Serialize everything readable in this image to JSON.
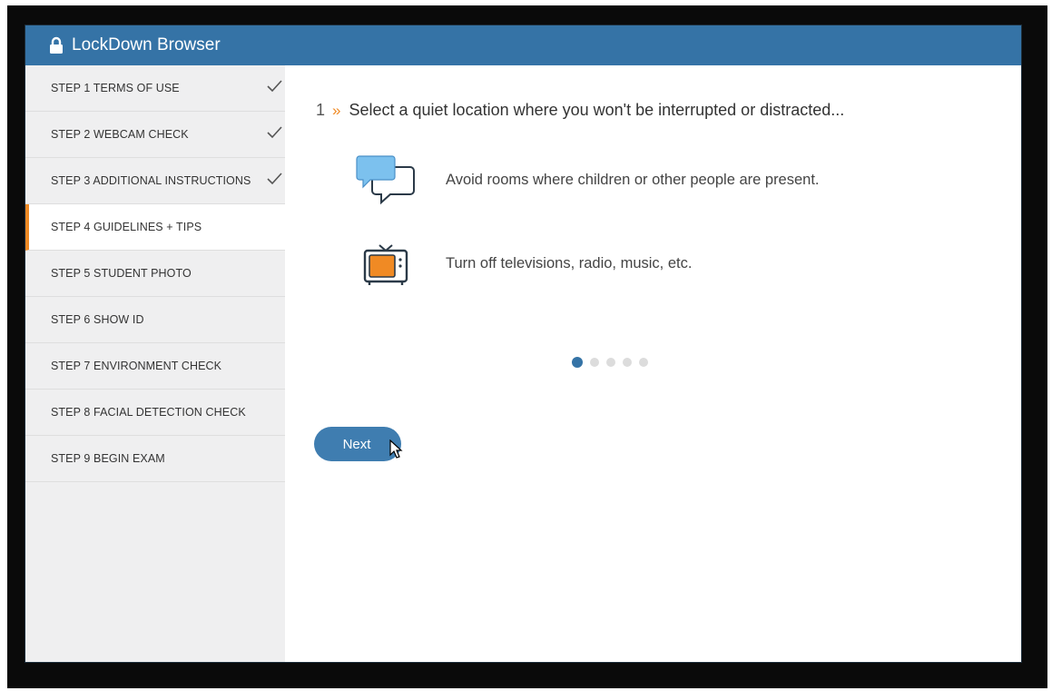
{
  "window": {
    "title": "LockDown Browser"
  },
  "sidebar": {
    "steps": [
      {
        "label": "STEP 1 TERMS OF USE",
        "completed": true
      },
      {
        "label": "STEP 2 WEBCAM CHECK",
        "completed": true
      },
      {
        "label": "STEP 3 ADDITIONAL INSTRUCTIONS",
        "completed": true
      },
      {
        "label": "STEP 4 GUIDELINES + TIPS",
        "active": true
      },
      {
        "label": "STEP 5 STUDENT PHOTO"
      },
      {
        "label": "STEP 6 SHOW ID"
      },
      {
        "label": "STEP 7 ENVIRONMENT CHECK"
      },
      {
        "label": "STEP 8 FACIAL DETECTION CHECK"
      },
      {
        "label": "STEP 9 BEGIN EXAM"
      }
    ]
  },
  "main": {
    "step_number": "1",
    "chevrons": "»",
    "heading": "Select a quiet location where you won't be interrupted or distracted...",
    "tips": [
      {
        "icon": "chat-bubbles-icon",
        "text": "Avoid rooms where children or other people are present."
      },
      {
        "icon": "television-icon",
        "text": "Turn off televisions, radio, music, etc."
      }
    ],
    "pagination": {
      "total": 5,
      "current": 1
    },
    "next_label": "Next"
  },
  "colors": {
    "titlebar": "#3573a6",
    "accent_orange": "#f08a24",
    "sidebar_bg": "#efeff0",
    "button": "#3f7db0"
  }
}
